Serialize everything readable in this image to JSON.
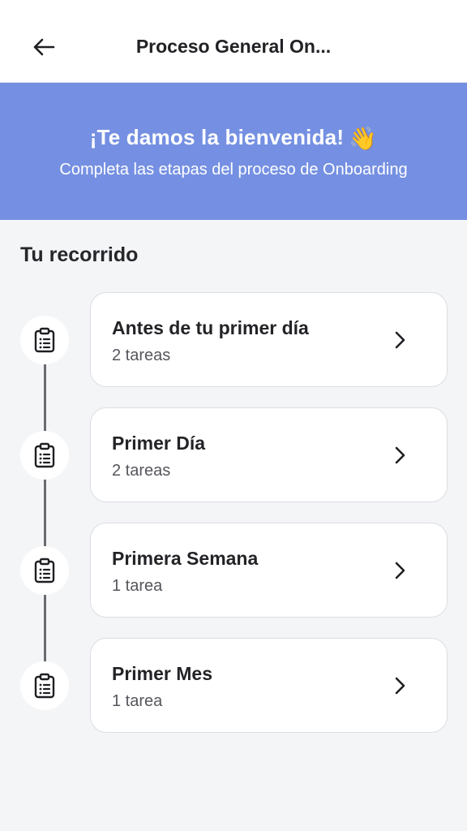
{
  "header": {
    "back_icon": "arrow-left-icon",
    "title": "Proceso General On..."
  },
  "banner": {
    "title": "¡Te damos la bienvenida!",
    "emoji": "👋",
    "subtitle": "Completa las etapas del proceso de Onboarding",
    "background_color": "#7590e2"
  },
  "journey": {
    "title": "Tu recorrido",
    "stages": [
      {
        "title": "Antes de tu primer día",
        "tasks": "2 tareas",
        "icon": "clipboard-list-icon"
      },
      {
        "title": "Primer Día",
        "tasks": "2 tareas",
        "icon": "clipboard-list-icon"
      },
      {
        "title": "Primera Semana",
        "tasks": "1 tarea",
        "icon": "clipboard-list-icon"
      },
      {
        "title": "Primer Mes",
        "tasks": "1 tarea",
        "icon": "clipboard-list-icon"
      }
    ]
  }
}
